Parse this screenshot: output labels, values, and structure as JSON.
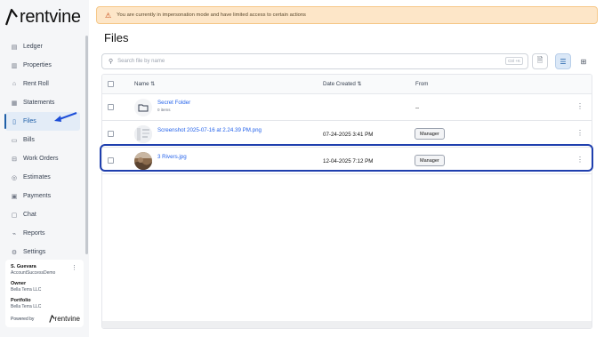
{
  "brand": {
    "name": "rentvine"
  },
  "sidebar": {
    "items": [
      {
        "label": "Ledger",
        "icon": "ledger-icon",
        "active": false
      },
      {
        "label": "Properties",
        "icon": "properties-icon",
        "active": false
      },
      {
        "label": "Rent Roll",
        "icon": "rent-roll-icon",
        "active": false
      },
      {
        "label": "Statements",
        "icon": "statements-icon",
        "active": false
      },
      {
        "label": "Files",
        "icon": "files-icon",
        "active": true
      },
      {
        "label": "Bills",
        "icon": "bills-icon",
        "active": false
      },
      {
        "label": "Work Orders",
        "icon": "work-orders-icon",
        "active": false
      },
      {
        "label": "Estimates",
        "icon": "estimates-icon",
        "active": false
      },
      {
        "label": "Payments",
        "icon": "payments-icon",
        "active": false
      },
      {
        "label": "Chat",
        "icon": "chat-icon",
        "active": false
      },
      {
        "label": "Reports",
        "icon": "reports-icon",
        "active": false
      },
      {
        "label": "Settings",
        "icon": "settings-icon",
        "active": false
      }
    ]
  },
  "user": {
    "name": "S. Guevara",
    "account": "AccountSuccessDemo",
    "owner_label": "Owner",
    "owner_value": "Bella Terra LLC",
    "portfolio_label": "Portfolio",
    "portfolio_value": "Bella Terra LLC",
    "powered_by": "Powered by",
    "powered_brand": "rentvine"
  },
  "banner": {
    "text": "You are currently in impersonation mode and have limited access to certain actions"
  },
  "page": {
    "title": "Files"
  },
  "search": {
    "placeholder": "Search file by name",
    "shortcut": "Ctrl +K"
  },
  "table": {
    "columns": {
      "name": "Name",
      "date": "Date Created",
      "from": "From"
    },
    "rows": [
      {
        "type": "folder",
        "name": "Secret Folder",
        "sub": "0 items",
        "date": "",
        "from": "--"
      },
      {
        "type": "image",
        "name": "Screenshot 2025-07-16 at 2.24.39 PM.png",
        "sub": "",
        "date": "07-24-2025 3:41 PM",
        "from": "Manager"
      },
      {
        "type": "image",
        "name": "3 Rivers.jpg",
        "sub": "",
        "date": "12-04-2025 7:12 PM",
        "from": "Manager"
      }
    ]
  },
  "colors": {
    "accent": "#1f5fa8",
    "highlight": "#1f3fae",
    "banner_bg": "#fde6c8",
    "link": "#2563eb"
  }
}
